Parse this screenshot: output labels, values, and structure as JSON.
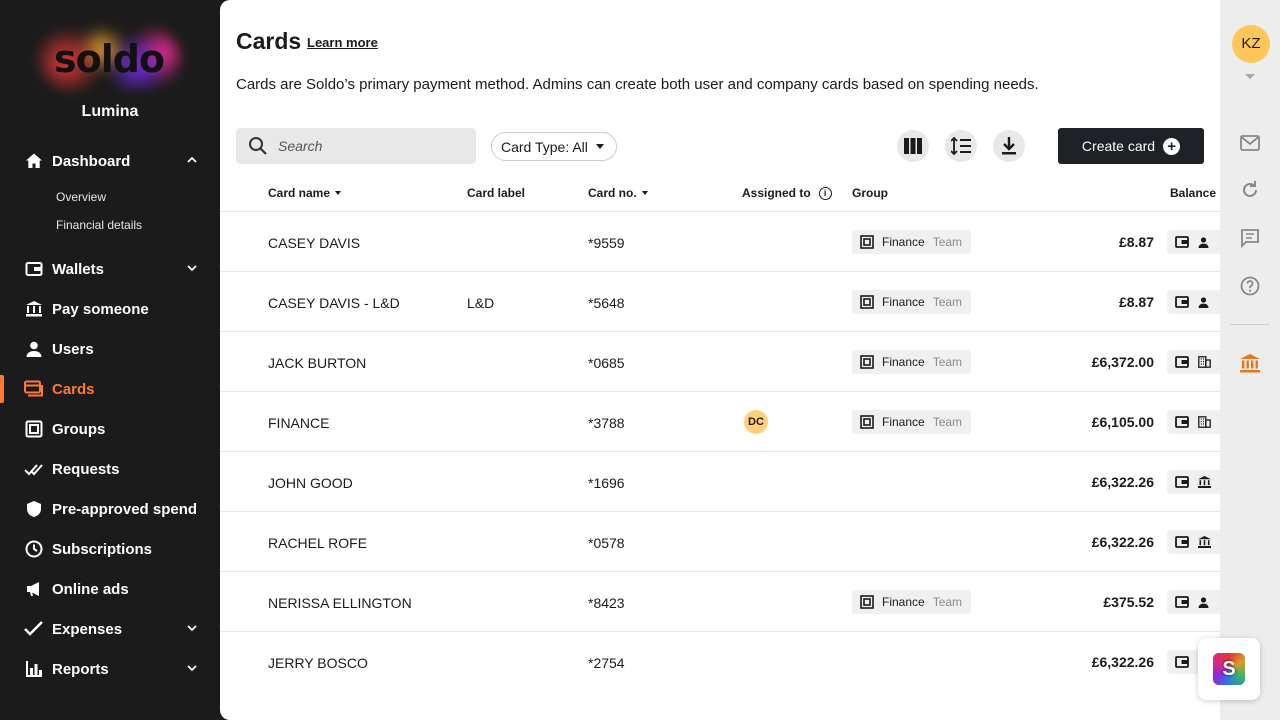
{
  "brand": {
    "logo_text": "soldo",
    "company": "Lumina"
  },
  "sidebar": {
    "items": [
      {
        "label": "Dashboard",
        "icon": "home-icon",
        "expanded": true
      },
      {
        "label": "Wallets",
        "icon": "wallet-icon"
      },
      {
        "label": "Pay someone",
        "icon": "pay-someone-icon"
      },
      {
        "label": "Users",
        "icon": "user-icon"
      },
      {
        "label": "Cards",
        "icon": "cards-icon",
        "active": true
      },
      {
        "label": "Groups",
        "icon": "groups-icon"
      },
      {
        "label": "Requests",
        "icon": "requests-icon"
      },
      {
        "label": "Pre-approved spend",
        "icon": "shield-icon"
      },
      {
        "label": "Subscriptions",
        "icon": "clock-icon"
      },
      {
        "label": "Online ads",
        "icon": "megaphone-icon"
      },
      {
        "label": "Expenses",
        "icon": "check-icon"
      },
      {
        "label": "Reports",
        "icon": "bar-chart-icon"
      }
    ],
    "dashboard_sub": [
      "Overview",
      "Financial details"
    ]
  },
  "page": {
    "title": "Cards",
    "learn_more": "Learn more",
    "description": "Cards are Soldo’s primary payment method. Admins can create both user and company cards based on spending needs."
  },
  "toolbar": {
    "search_placeholder": "Search",
    "filter_label": "Card Type: All",
    "create_label": "Create card"
  },
  "table": {
    "headers": {
      "name": "Card name",
      "label": "Card label",
      "number": "Card no.",
      "assigned": "Assigned to",
      "group": "Group",
      "balance": "Balance"
    },
    "rows": [
      {
        "name": "CASEY DAVIS",
        "label": "",
        "number": "*9559",
        "assigned": "",
        "group": "Finance",
        "group_type": "Team",
        "balance": "£8.87",
        "owner_icon": "person-icon"
      },
      {
        "name": "CASEY DAVIS - L&D",
        "label": "L&D",
        "number": "*5648",
        "assigned": "",
        "group": "Finance",
        "group_type": "Team",
        "balance": "£8.87",
        "owner_icon": "person-icon"
      },
      {
        "name": "JACK BURTON",
        "label": "",
        "number": "*0685",
        "assigned": "",
        "group": "Finance",
        "group_type": "Team",
        "balance": "£6,372.00",
        "owner_icon": "building-icon"
      },
      {
        "name": "FINANCE",
        "label": "",
        "number": "*3788",
        "assigned": "DC",
        "group": "Finance",
        "group_type": "Team",
        "balance": "£6,105.00",
        "owner_icon": "building-icon"
      },
      {
        "name": "JOHN GOOD",
        "label": "",
        "number": "*1696",
        "assigned": "",
        "group": "",
        "group_type": "",
        "balance": "£6,322.26",
        "owner_icon": "bank-icon"
      },
      {
        "name": "RACHEL ROFE",
        "label": "",
        "number": "*0578",
        "assigned": "",
        "group": "",
        "group_type": "",
        "balance": "£6,322.26",
        "owner_icon": "bank-icon"
      },
      {
        "name": "NERISSA ELLINGTON",
        "label": "",
        "number": "*8423",
        "assigned": "",
        "group": "Finance",
        "group_type": "Team",
        "balance": "£375.52",
        "owner_icon": "person-icon"
      },
      {
        "name": "JERRY BOSCO",
        "label": "",
        "number": "*2754",
        "assigned": "",
        "group": "",
        "group_type": "",
        "balance": "£6,322.26",
        "owner_icon": ""
      }
    ]
  },
  "account": {
    "initials": "KZ"
  },
  "rail_icons": [
    "mail-icon",
    "refresh-icon",
    "chat-icon",
    "help-icon",
    "bank-icon"
  ],
  "support_badge": {
    "letter": "S"
  },
  "colors": {
    "accent": "#ff7a2f",
    "sidebar_bg": "#1b1b1b",
    "primary_button": "#1e2226",
    "avatar": "#ffc75a"
  }
}
